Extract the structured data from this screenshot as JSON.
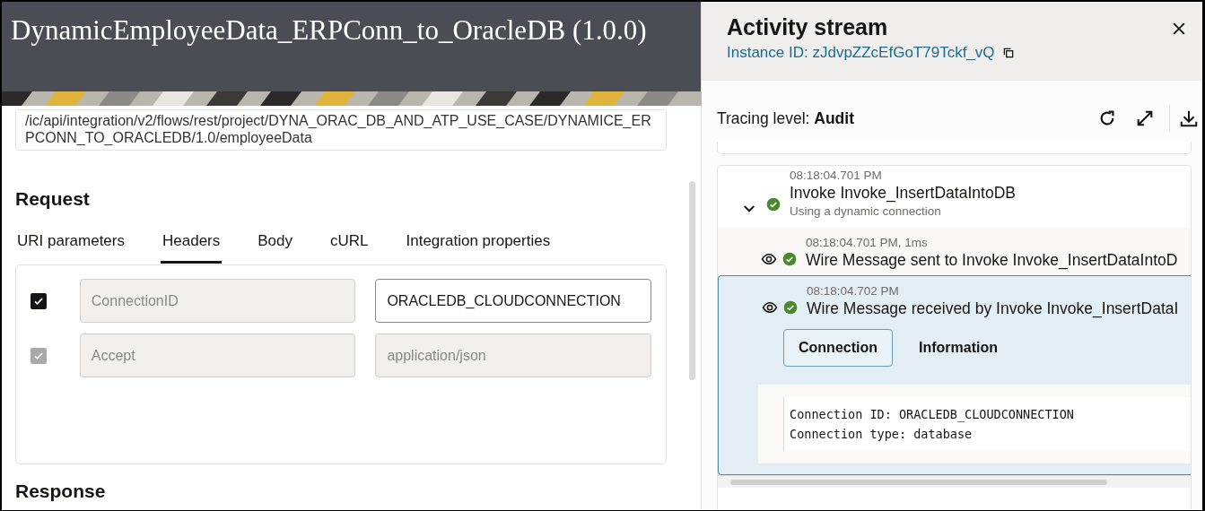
{
  "header": {
    "title": "DynamicEmployeeData_ERPConn_to_OracleDB (1.0.0)"
  },
  "endpoint": {
    "url": "/ic/api/integration/v2/flows/rest/project/DYNA_ORAC_DB_AND_ATP_USE_CASE/DYNAMICE_ERPCONN_TO_ORACLEDB/1.0/employeeData"
  },
  "request": {
    "heading": "Request",
    "tabs": [
      {
        "label": "URI parameters",
        "selected": false
      },
      {
        "label": "Headers",
        "selected": true
      },
      {
        "label": "Body",
        "selected": false
      },
      {
        "label": "cURL",
        "selected": false
      },
      {
        "label": "Integration properties",
        "selected": false
      }
    ],
    "headers": [
      {
        "checked": true,
        "disabled": false,
        "name": "ConnectionID",
        "value": "ORACLEDB_CLOUDCONNECTION"
      },
      {
        "checked": true,
        "disabled": true,
        "name": "Accept",
        "value": "application/json"
      }
    ]
  },
  "response": {
    "heading": "Response"
  },
  "activity_stream": {
    "title": "Activity stream",
    "instance_id": "Instance ID: zJdvpZZcEfGoT79Tckf_vQ",
    "tracing_label": "Tracing level:",
    "tracing_level": "Audit",
    "events": [
      {
        "time": "08:18:04.701 PM",
        "title": "Invoke Invoke_InsertDataIntoDB",
        "subtitle": "Using a dynamic connection",
        "expanded": true,
        "children": [
          {
            "time": "08:18:04.701 PM, 1ms",
            "title": "Wire Message sent to Invoke Invoke_InsertDataIntoD",
            "selected": false
          },
          {
            "time": "08:18:04.702 PM",
            "title": "Wire Message received by Invoke Invoke_InsertDataI",
            "selected": true,
            "tabs": [
              {
                "label": "Connection",
                "selected": true
              },
              {
                "label": "Information",
                "selected": false
              }
            ],
            "details": [
              "Connection ID: ORACLEDB_CLOUDCONNECTION",
              "Connection type: database"
            ]
          }
        ]
      }
    ]
  }
}
